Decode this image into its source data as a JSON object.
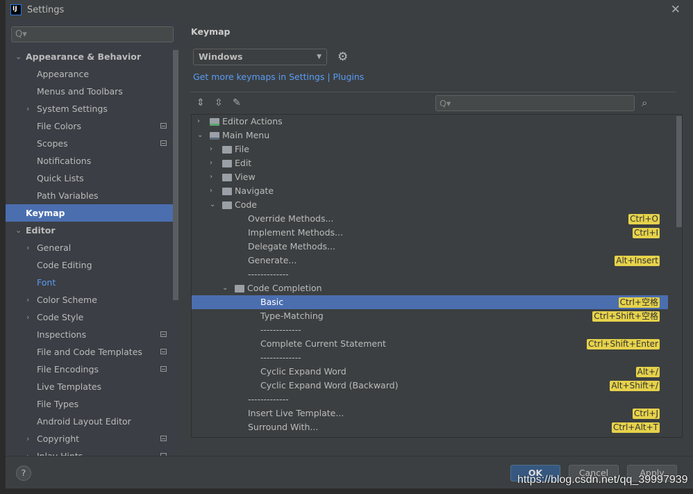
{
  "window": {
    "title": "Settings",
    "logo": "IJ",
    "close": "✕"
  },
  "sidebar": {
    "search_placeholder": "Q▾",
    "items": [
      {
        "label": "Appearance & Behavior",
        "level": 0,
        "arrow": "down",
        "bold": true
      },
      {
        "label": "Appearance",
        "level": 1
      },
      {
        "label": "Menus and Toolbars",
        "level": 1
      },
      {
        "label": "System Settings",
        "level": 1,
        "arrow": "right"
      },
      {
        "label": "File Colors",
        "level": 1,
        "mark": true
      },
      {
        "label": "Scopes",
        "level": 1,
        "mark": true
      },
      {
        "label": "Notifications",
        "level": 1
      },
      {
        "label": "Quick Lists",
        "level": 1
      },
      {
        "label": "Path Variables",
        "level": 1
      },
      {
        "label": "Keymap",
        "level": 0,
        "bold": true,
        "selected": true
      },
      {
        "label": "Editor",
        "level": 0,
        "arrow": "down",
        "bold": true
      },
      {
        "label": "General",
        "level": 1,
        "arrow": "right"
      },
      {
        "label": "Code Editing",
        "level": 1
      },
      {
        "label": "Font",
        "level": 1,
        "link": true
      },
      {
        "label": "Color Scheme",
        "level": 1,
        "arrow": "right"
      },
      {
        "label": "Code Style",
        "level": 1,
        "arrow": "right"
      },
      {
        "label": "Inspections",
        "level": 1,
        "mark": true
      },
      {
        "label": "File and Code Templates",
        "level": 1,
        "mark": true
      },
      {
        "label": "File Encodings",
        "level": 1,
        "mark": true
      },
      {
        "label": "Live Templates",
        "level": 1
      },
      {
        "label": "File Types",
        "level": 1
      },
      {
        "label": "Android Layout Editor",
        "level": 1
      },
      {
        "label": "Copyright",
        "level": 1,
        "arrow": "right",
        "mark": true
      },
      {
        "label": "Inlay Hints",
        "level": 1,
        "arrow": "right",
        "mark": true
      }
    ]
  },
  "main": {
    "heading": "Keymap",
    "keymap_value": "Windows",
    "link_text": "Get more keymaps in Settings | Plugins",
    "filter_placeholder": "Q▾",
    "tree": [
      {
        "label": "Editor Actions",
        "level": 0,
        "arrow": "right",
        "icon": "act"
      },
      {
        "label": "Main Menu",
        "level": 0,
        "arrow": "down",
        "icon": "menu"
      },
      {
        "label": "File",
        "level": 1,
        "arrow": "right",
        "icon": "folder"
      },
      {
        "label": "Edit",
        "level": 1,
        "arrow": "right",
        "icon": "folder"
      },
      {
        "label": "View",
        "level": 1,
        "arrow": "right",
        "icon": "folder"
      },
      {
        "label": "Navigate",
        "level": 1,
        "arrow": "right",
        "icon": "folder"
      },
      {
        "label": "Code",
        "level": 1,
        "arrow": "down",
        "icon": "folder"
      },
      {
        "label": "Override Methods...",
        "level": 2,
        "shortcut": "Ctrl+O"
      },
      {
        "label": "Implement Methods...",
        "level": 2,
        "shortcut": "Ctrl+I"
      },
      {
        "label": "Delegate Methods...",
        "level": 2
      },
      {
        "label": "Generate...",
        "level": 2,
        "shortcut": "Alt+Insert"
      },
      {
        "label": "-------------",
        "level": 2
      },
      {
        "label": "Code Completion",
        "level": 2,
        "arrow": "down",
        "icon": "folder"
      },
      {
        "label": "Basic",
        "level": 3,
        "shortcut": "Ctrl+空格",
        "selected": true
      },
      {
        "label": "Type-Matching",
        "level": 3,
        "shortcut": "Ctrl+Shift+空格"
      },
      {
        "label": "-------------",
        "level": 3
      },
      {
        "label": "Complete Current Statement",
        "level": 3,
        "shortcut": "Ctrl+Shift+Enter"
      },
      {
        "label": "-------------",
        "level": 3
      },
      {
        "label": "Cyclic Expand Word",
        "level": 3,
        "shortcut": "Alt+/"
      },
      {
        "label": "Cyclic Expand Word (Backward)",
        "level": 3,
        "shortcut": "Alt+Shift+/"
      },
      {
        "label": "-------------",
        "level": 2
      },
      {
        "label": "Insert Live Template...",
        "level": 2,
        "shortcut": "Ctrl+J"
      },
      {
        "label": "Surround With...",
        "level": 2,
        "shortcut": "Ctrl+Alt+T"
      }
    ]
  },
  "footer": {
    "help": "?",
    "ok": "OK",
    "cancel": "Cancel",
    "apply": "Apply"
  },
  "watermark": "https://blog.csdn.net/qq_39997939"
}
